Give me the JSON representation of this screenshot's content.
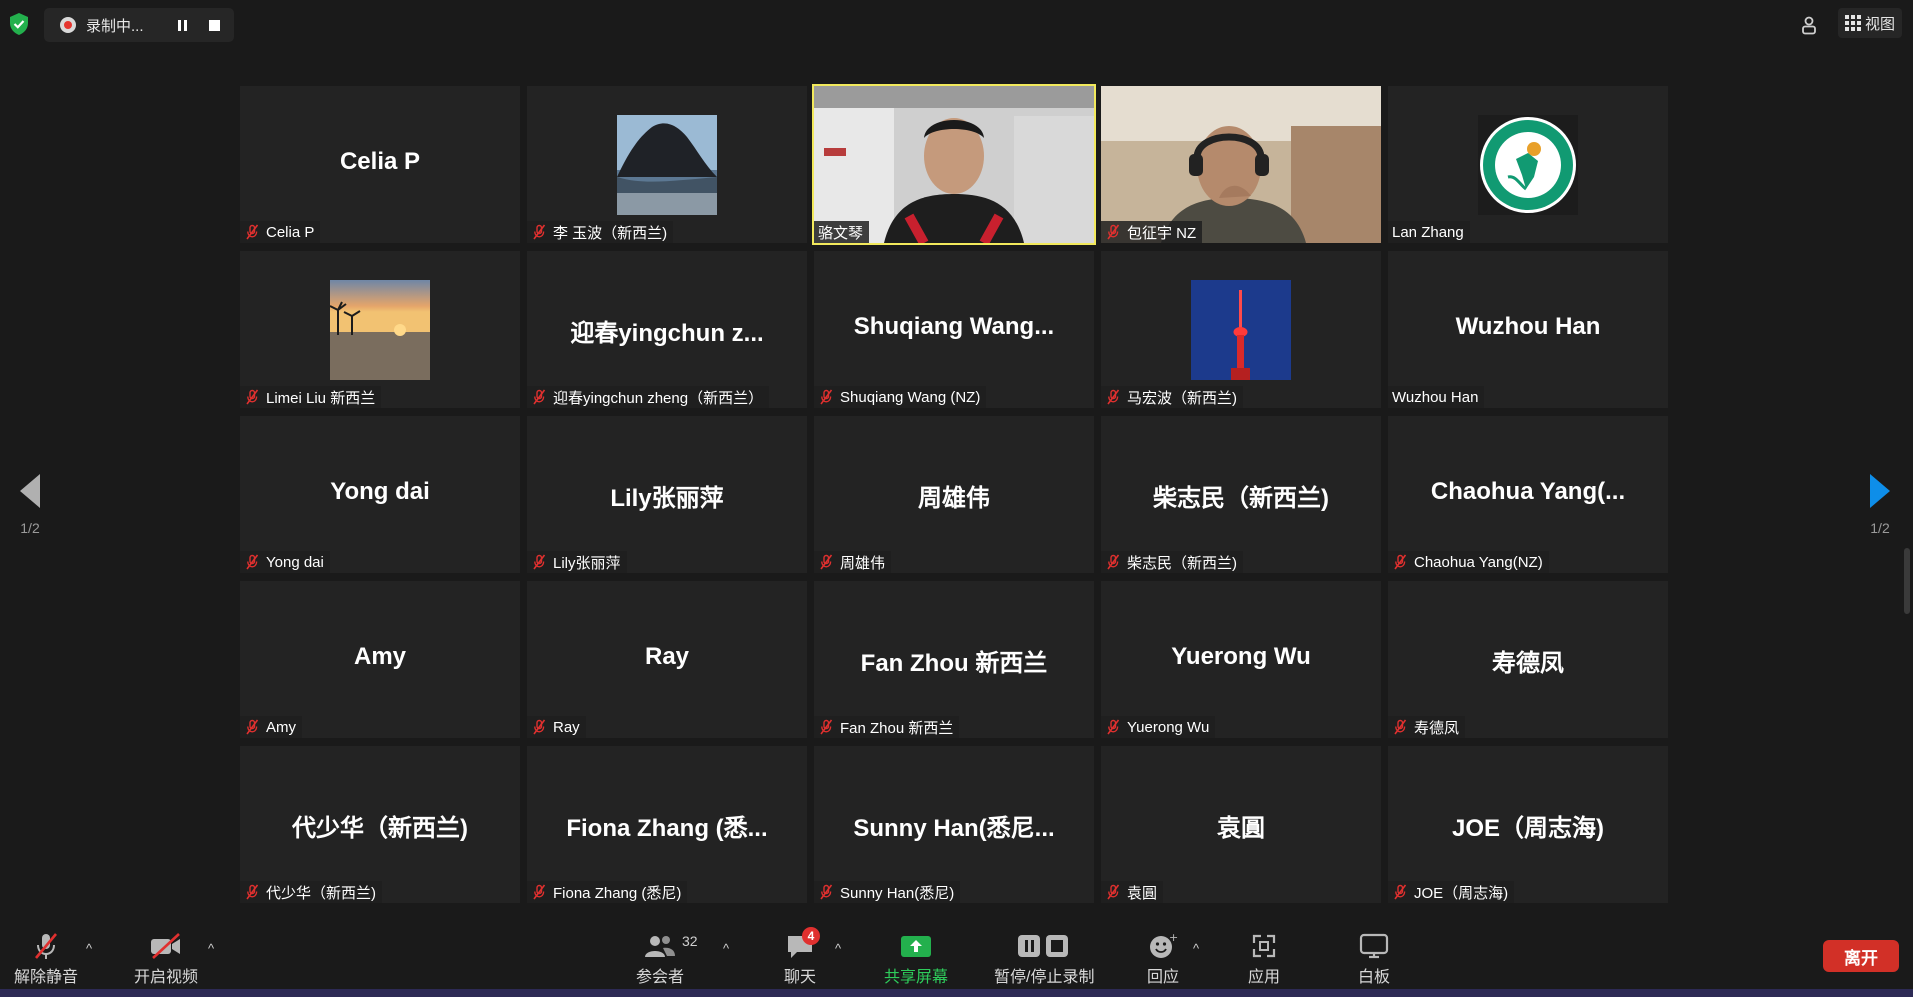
{
  "recording": {
    "label": "录制中...",
    "colors": {
      "dot": "#e5352f"
    }
  },
  "top_right": {
    "view_label": "视图"
  },
  "pager": {
    "left_page": "1/2",
    "right_page": "1/2",
    "colors": {
      "next": "#0e8ee9"
    }
  },
  "participants": [
    {
      "big_name": "Celia P",
      "label": "Celia P",
      "muted": true,
      "media": "name"
    },
    {
      "big_name": "",
      "label": "李 玉波（新西兰)",
      "muted": true,
      "media": "photo-rock"
    },
    {
      "big_name": "",
      "label": "骆文琴",
      "muted": false,
      "media": "video-man-1",
      "active_speaker": true
    },
    {
      "big_name": "",
      "label": "包征宇 NZ",
      "muted": true,
      "media": "video-man-2"
    },
    {
      "big_name": "",
      "label": "Lan Zhang",
      "muted": false,
      "media": "logo-volleyball"
    },
    {
      "big_name": "",
      "label": "Limei Liu 新西兰",
      "muted": true,
      "media": "photo-sunset"
    },
    {
      "big_name": "迎春yingchun z...",
      "label": "迎春yingchun zheng（新西兰）",
      "muted": true,
      "media": "name"
    },
    {
      "big_name": "Shuqiang Wang...",
      "label": "Shuqiang Wang (NZ)",
      "muted": true,
      "media": "name"
    },
    {
      "big_name": "",
      "label": "马宏波（新西兰)",
      "muted": true,
      "media": "photo-tower"
    },
    {
      "big_name": "Wuzhou Han",
      "label": "Wuzhou Han",
      "muted": false,
      "media": "name"
    },
    {
      "big_name": "Yong dai",
      "label": "Yong dai",
      "muted": true,
      "media": "name"
    },
    {
      "big_name": "Lily张丽萍",
      "label": "Lily张丽萍",
      "muted": true,
      "media": "name"
    },
    {
      "big_name": "周雄伟",
      "label": "周雄伟",
      "muted": true,
      "media": "name"
    },
    {
      "big_name": "柴志民（新西兰)",
      "label": "柴志民（新西兰)",
      "muted": true,
      "media": "name"
    },
    {
      "big_name": "Chaohua Yang(...",
      "label": "Chaohua Yang(NZ)",
      "muted": true,
      "media": "name"
    },
    {
      "big_name": "Amy",
      "label": "Amy",
      "muted": true,
      "media": "name"
    },
    {
      "big_name": "Ray",
      "label": "Ray",
      "muted": true,
      "media": "name"
    },
    {
      "big_name": "Fan Zhou 新西兰",
      "label": "Fan Zhou 新西兰",
      "muted": true,
      "media": "name"
    },
    {
      "big_name": "Yuerong Wu",
      "label": "Yuerong Wu",
      "muted": true,
      "media": "name"
    },
    {
      "big_name": "寿德凤",
      "label": "寿德凤",
      "muted": true,
      "media": "name"
    },
    {
      "big_name": "代少华（新西兰)",
      "label": "代少华（新西兰)",
      "muted": true,
      "media": "name"
    },
    {
      "big_name": "Fiona Zhang (悉...",
      "label": "Fiona Zhang (悉尼)",
      "muted": true,
      "media": "name"
    },
    {
      "big_name": "Sunny Han(悉尼...",
      "label": "Sunny Han(悉尼)",
      "muted": true,
      "media": "name"
    },
    {
      "big_name": "袁圓",
      "label": "袁圓",
      "muted": true,
      "media": "name"
    },
    {
      "big_name": "JOE（周志海)",
      "label": "JOE（周志海)",
      "muted": true,
      "media": "name"
    }
  ],
  "toolbar": {
    "unmute": "解除静音",
    "start_video": "开启视频",
    "participants": "参会者",
    "participants_count": "32",
    "chat": "聊天",
    "chat_badge": "4",
    "share": "共享屏幕",
    "record": "暂停/停止录制",
    "react": "回应",
    "apps": "应用",
    "whiteboard": "白板",
    "leave": "离开",
    "colors": {
      "share": "#2ecc5b",
      "leave": "#d23027",
      "muted_icon": "#e0302f"
    }
  }
}
